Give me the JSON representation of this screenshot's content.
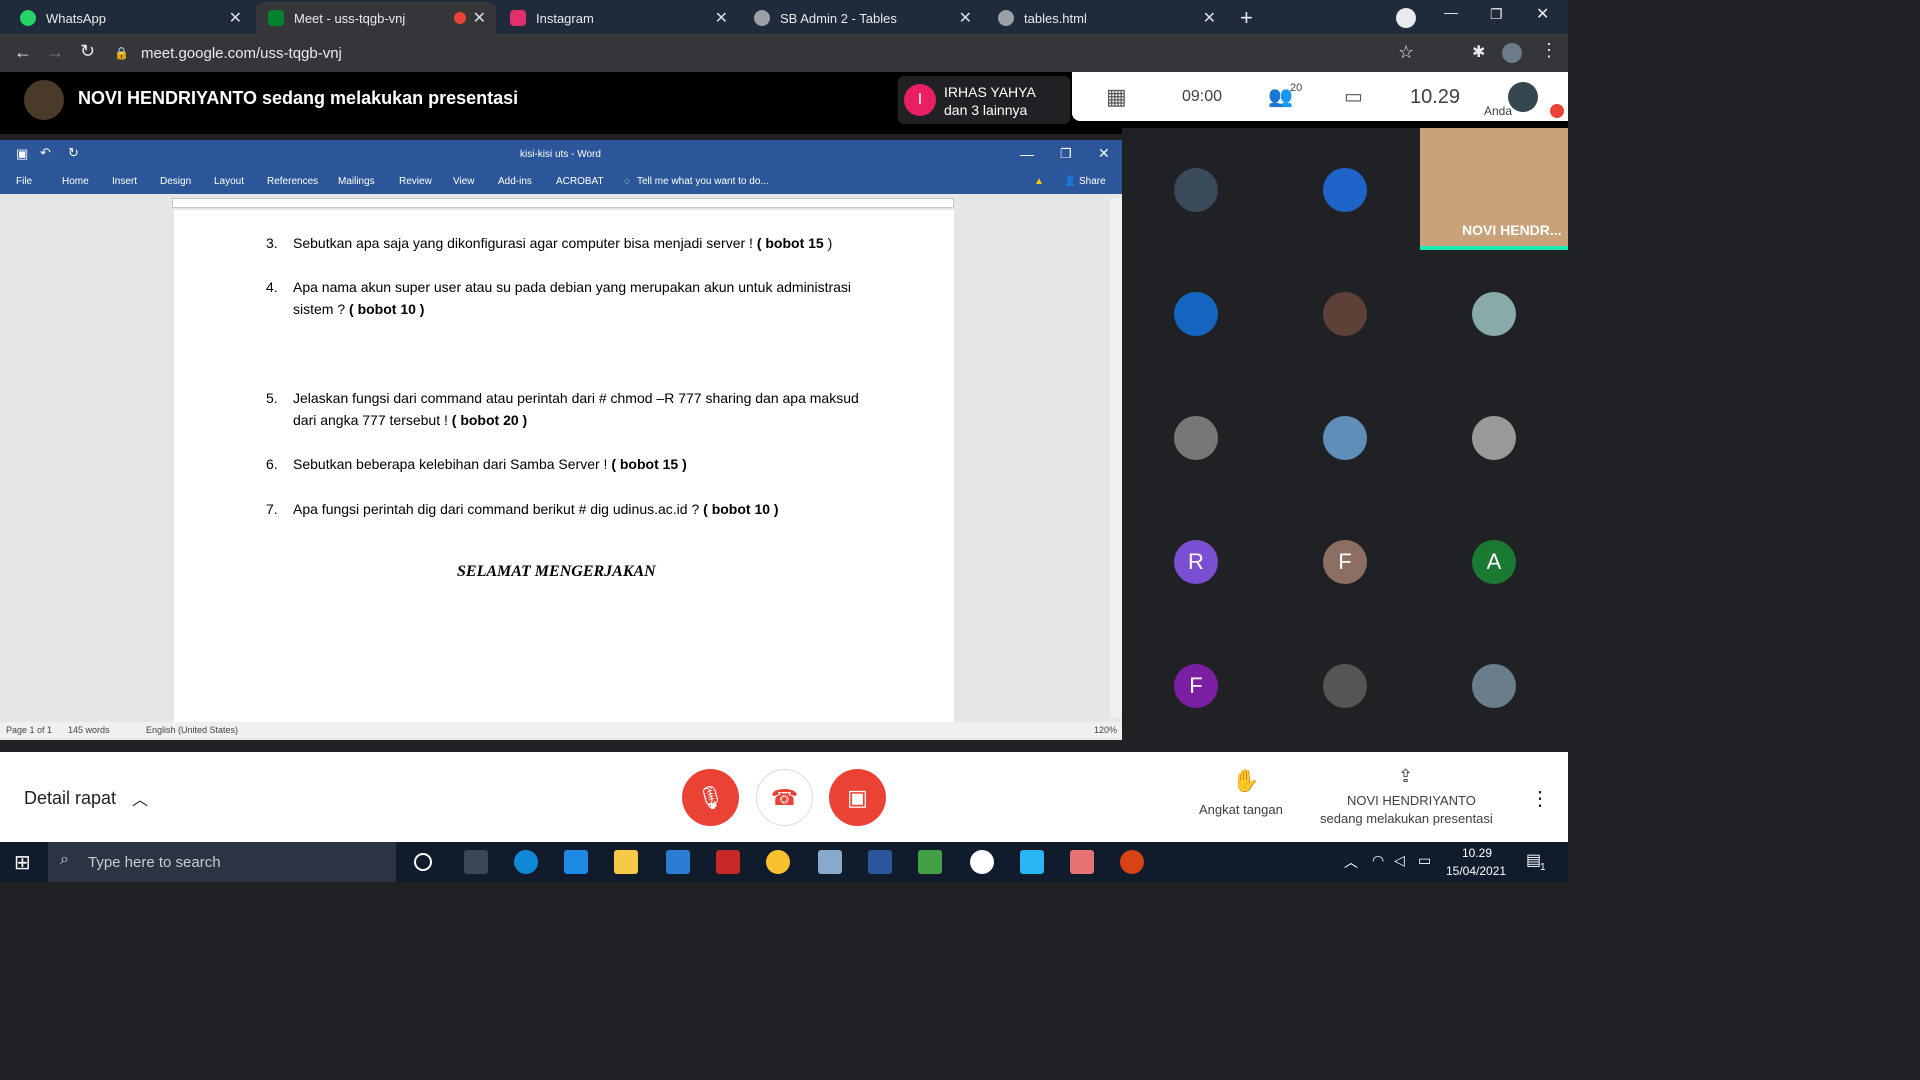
{
  "browser": {
    "tabs": [
      {
        "title": "WhatsApp",
        "color": "#25d366"
      },
      {
        "title": "Meet - uss-tqgb-vnj",
        "color": "#00832d"
      },
      {
        "title": "Instagram",
        "color": "#e1306c"
      },
      {
        "title": "SB Admin 2 - Tables",
        "color": "#9aa0a6"
      },
      {
        "title": "tables.html",
        "color": "#9aa0a6"
      }
    ],
    "url": "meet.google.com/uss-tqgb-vnj"
  },
  "meet": {
    "presenter_banner": "NOVI HENDRIYANTO sedang melakukan presentasi",
    "speaker_initial": "I",
    "speaker_name": "IRHAS YAHYA",
    "speaker_others": "dan 3 lainnya",
    "time_left": "09:00",
    "participants_count": "20",
    "clock": "10.29",
    "self_label": "Anda",
    "self_tile_name": "NOVI HENDR...",
    "avatar_letters": [
      "R",
      "F",
      "A",
      "F"
    ],
    "meeting_details": "Detail rapat",
    "raise_hand": "Angkat tangan",
    "presenting_name": "NOVI HENDRIYANTO",
    "presenting_text": "sedang melakukan presentasi"
  },
  "word": {
    "title": "kisi-kisi uts - Word",
    "ribbon": [
      "File",
      "Home",
      "Insert",
      "Design",
      "Layout",
      "References",
      "Mailings",
      "Review",
      "View",
      "Add-ins",
      "ACROBAT"
    ],
    "tell_me": "Tell me what you want to do...",
    "share": "Share",
    "questions": [
      {
        "n": "3.",
        "text": "Sebutkan apa saja yang dikonfigurasi agar computer bisa menjadi server ! ",
        "bobot": "( bobot 15 ",
        "close": ")"
      },
      {
        "n": "4.",
        "text": "Apa nama akun super user atau su pada debian yang merupakan akun untuk administrasi sistem ? ",
        "bobot": "( bobot 10 )",
        "close": ""
      },
      {
        "n": "5.",
        "text": "Jelaskan fungsi dari command atau perintah dari # chmod –R 777 sharing dan apa maksud dari angka 777 tersebut ! ",
        "bobot": "( bobot 20 )",
        "close": ""
      },
      {
        "n": "6.",
        "text": "Sebutkan beberapa kelebihan dari Samba Server ! ",
        "bobot": "( bobot 15 )",
        "close": ""
      },
      {
        "n": "7.",
        "text": "Apa fungsi perintah dig dari command berikut # dig udinus.ac.id ? ",
        "bobot": "( bobot 10 )",
        "close": ""
      }
    ],
    "closing": "SELAMAT MENGERJAKAN",
    "status_page": "Page 1 of 1",
    "status_words": "145 words",
    "status_lang": "English (United States)",
    "zoom": "120%"
  },
  "taskbar": {
    "search_placeholder": "Type here to search",
    "time": "10.29",
    "date": "15/04/2021",
    "notif": "1"
  }
}
